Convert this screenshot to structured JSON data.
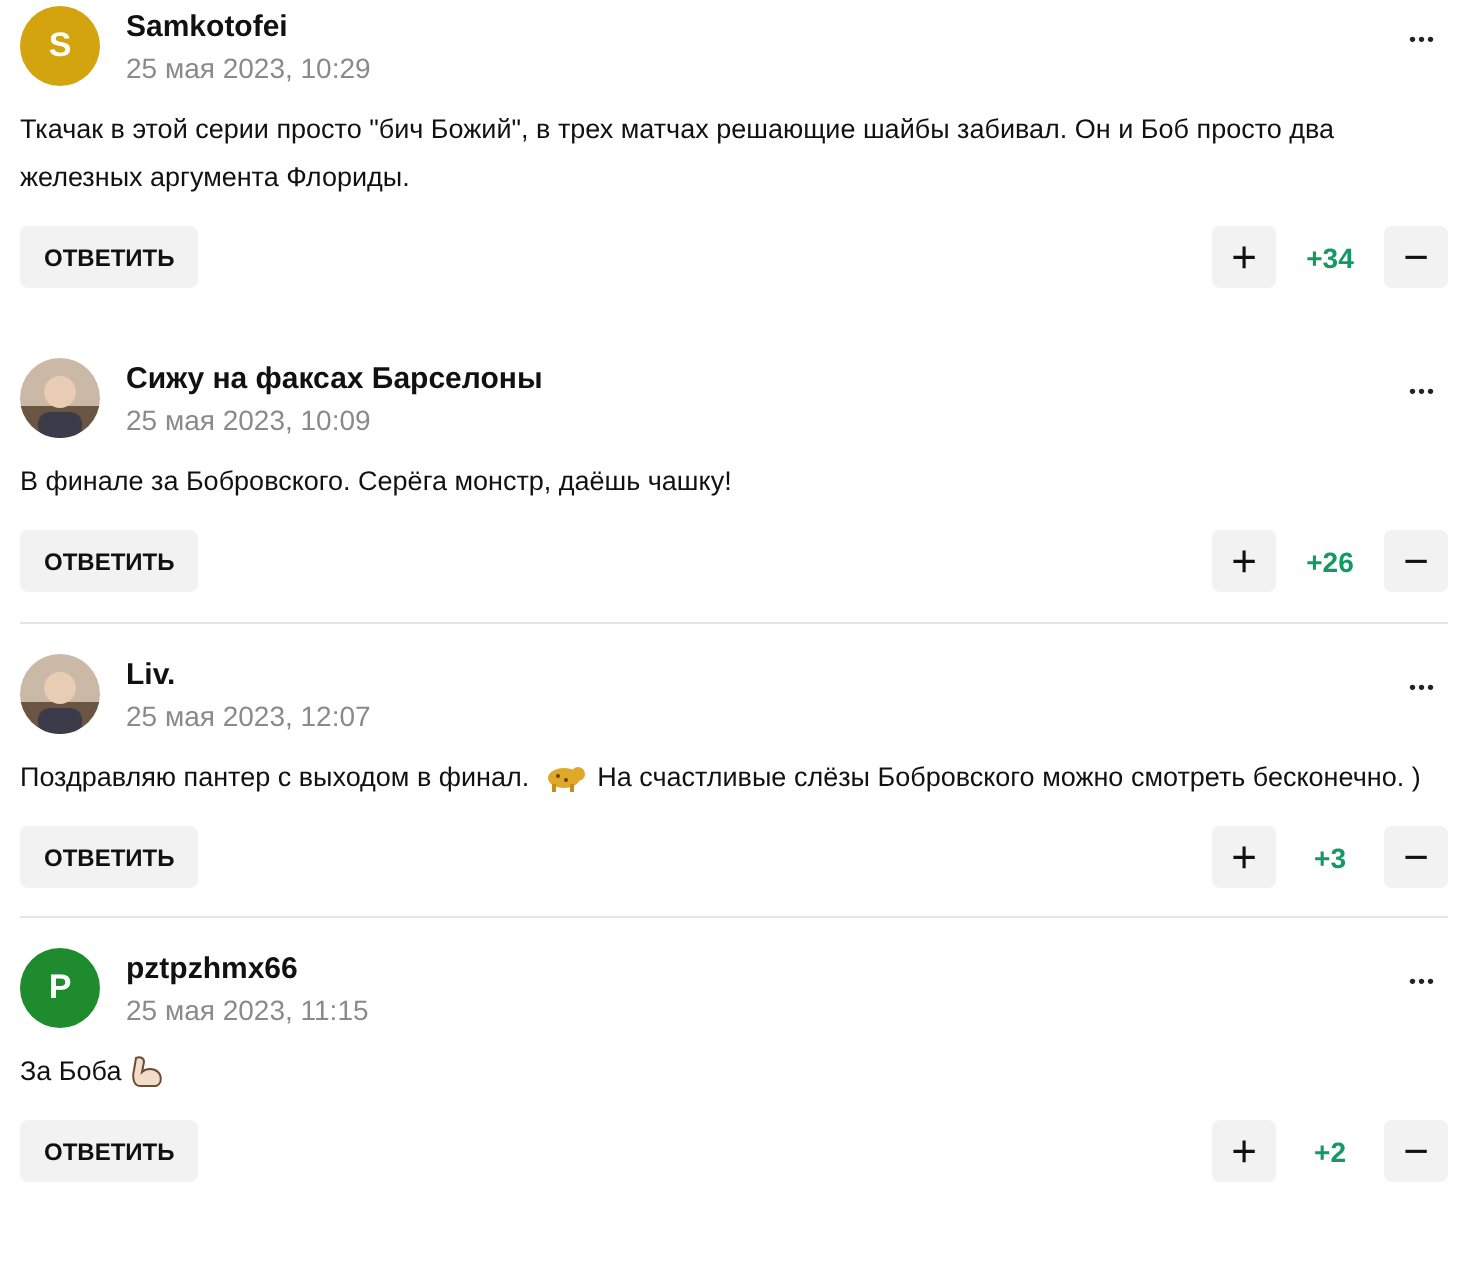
{
  "comments": [
    {
      "author": "Samkotofei",
      "avatar": {
        "kind": "letter",
        "letter": "S",
        "color": "#d4a40f"
      },
      "date": "25 мая 2023, 10:29",
      "body": [
        {
          "kind": "text",
          "text": "Ткачак в этой серии просто \"бич Божий\", в трех матчах решающие шайбы забивал. Он и Боб просто два железных аргумента Флориды."
        }
      ],
      "reply": "ОТВЕТИТЬ",
      "plus": "+",
      "score": "+34",
      "minus": "−",
      "menu": "•••"
    },
    {
      "author": "Сижу на факсах Барселоны",
      "avatar": {
        "kind": "picture"
      },
      "date": "25 мая 2023, 10:09",
      "body": [
        {
          "kind": "text",
          "text": "В финале за Бобровского. Серёга монстр, даёшь чашку!"
        }
      ],
      "reply": "ОТВЕТИТЬ",
      "plus": "+",
      "score": "+26",
      "minus": "−",
      "menu": "•••"
    },
    {
      "author": "Liv.",
      "avatar": {
        "kind": "picture"
      },
      "date": "25 мая 2023, 12:07",
      "body": [
        {
          "kind": "text",
          "text": "Поздравляю пантер с выходом в финал."
        },
        {
          "kind": "animal"
        },
        {
          "kind": "text",
          "text": "На счастливые слёзы Бобровского можно смотреть бесконечно. )"
        }
      ],
      "reply": "ОТВЕТИТЬ",
      "plus": "+",
      "score": "+3",
      "minus": "−",
      "menu": "•••"
    },
    {
      "author": "pztpzhmx66",
      "avatar": {
        "kind": "letter",
        "letter": "P",
        "color": "#1e8c2e"
      },
      "date": "25 мая 2023, 11:15",
      "body": [
        {
          "kind": "text",
          "text": "За Боба"
        },
        {
          "kind": "arm"
        }
      ],
      "reply": "ОТВЕТИТЬ",
      "plus": "+",
      "score": "+2",
      "minus": "−",
      "menu": "•••"
    }
  ]
}
